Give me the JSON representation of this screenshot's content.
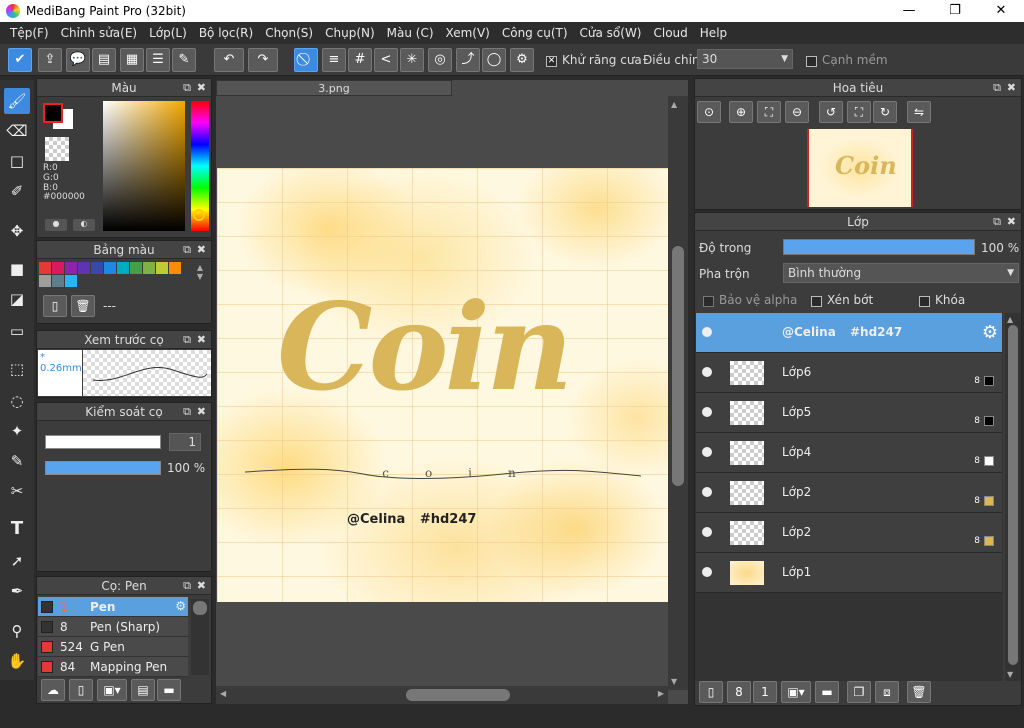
{
  "window": {
    "title": "MediBang Paint Pro (32bit)",
    "minimize": "—",
    "maximize": "❐",
    "close": "✕"
  },
  "menu": [
    "Tệp(F)",
    "Chỉnh sửa(E)",
    "Lớp(L)",
    "Bộ lọc(R)",
    "Chọn(S)",
    "Chụp(N)",
    "Màu (C)",
    "Xem(V)",
    "Công cụ(T)",
    "Cửa sổ(W)",
    "Cloud",
    "Help"
  ],
  "toolbar": {
    "antialias_label": "Khử răng cưa",
    "antialias_checked": "✕",
    "adjust_label": "Điều chỉnh",
    "adjust_value": "30",
    "smooth_label": "Cạnh mềm"
  },
  "color_panel": {
    "title": "Màu",
    "r": "R:0",
    "g": "G:0",
    "b": "B:0",
    "hex": "#000000",
    "foreground": "#000000",
    "background": "#ffffff"
  },
  "palette_panel": {
    "title": "Bảng màu",
    "swatches": [
      "#e53935",
      "#d81b60",
      "#8e24aa",
      "#5e35b1",
      "#3949ab",
      "#1e88e5",
      "#00acc1",
      "#43a047",
      "#7cb342",
      "#c0ca33",
      "#fb8c00",
      "#9e9e9e",
      "#607d8b",
      "#29b6f6"
    ],
    "name": "---"
  },
  "brush_preview": {
    "title": "Xem trước cọ",
    "size": "* 0.26mm"
  },
  "brush_control": {
    "title": "Kiểm soát cọ",
    "size": "1",
    "opacity": "100 %",
    "opacity_fraction": 1.0
  },
  "brush_list": {
    "title": "Cọ: Pen",
    "items": [
      {
        "size": "1",
        "name": "Pen",
        "color": "#333333"
      },
      {
        "size": "8",
        "name": "Pen (Sharp)",
        "color": "#333333"
      },
      {
        "size": "524",
        "name": "G Pen",
        "color": "#e53935"
      },
      {
        "size": "84",
        "name": "Mapping Pen",
        "color": "#e53935"
      }
    ]
  },
  "canvas": {
    "tab": "3.png",
    "art_title": "Coin",
    "art_subtitle": "coin",
    "credit": "@Celina #hd247"
  },
  "navigator": {
    "title": "Hoa tiêu"
  },
  "layers_panel": {
    "title": "Lớp",
    "opacity_label": "Độ trong",
    "opacity_value": "100 %",
    "opacity_fraction": 1.0,
    "blend_label": "Pha trộn",
    "blend_value": "Bình thường",
    "protect_alpha": "Bảo vệ alpha",
    "clipping": "Xén bớt",
    "lock": "Khóa",
    "layers": [
      {
        "name": "@Celina #hd247",
        "num": "",
        "swatch": ""
      },
      {
        "name": "Lớp6",
        "num": "8",
        "swatch": "#000000"
      },
      {
        "name": "Lớp5",
        "num": "8",
        "swatch": "#000000"
      },
      {
        "name": "Lớp4",
        "num": "8",
        "swatch": "#ffffff"
      },
      {
        "name": "Lớp2",
        "num": "8",
        "swatch": "#d9b65a"
      },
      {
        "name": "Lớp2",
        "num": "8",
        "swatch": "#d9b65a"
      },
      {
        "name": "Lớp1",
        "num": "",
        "swatch": ""
      }
    ]
  }
}
